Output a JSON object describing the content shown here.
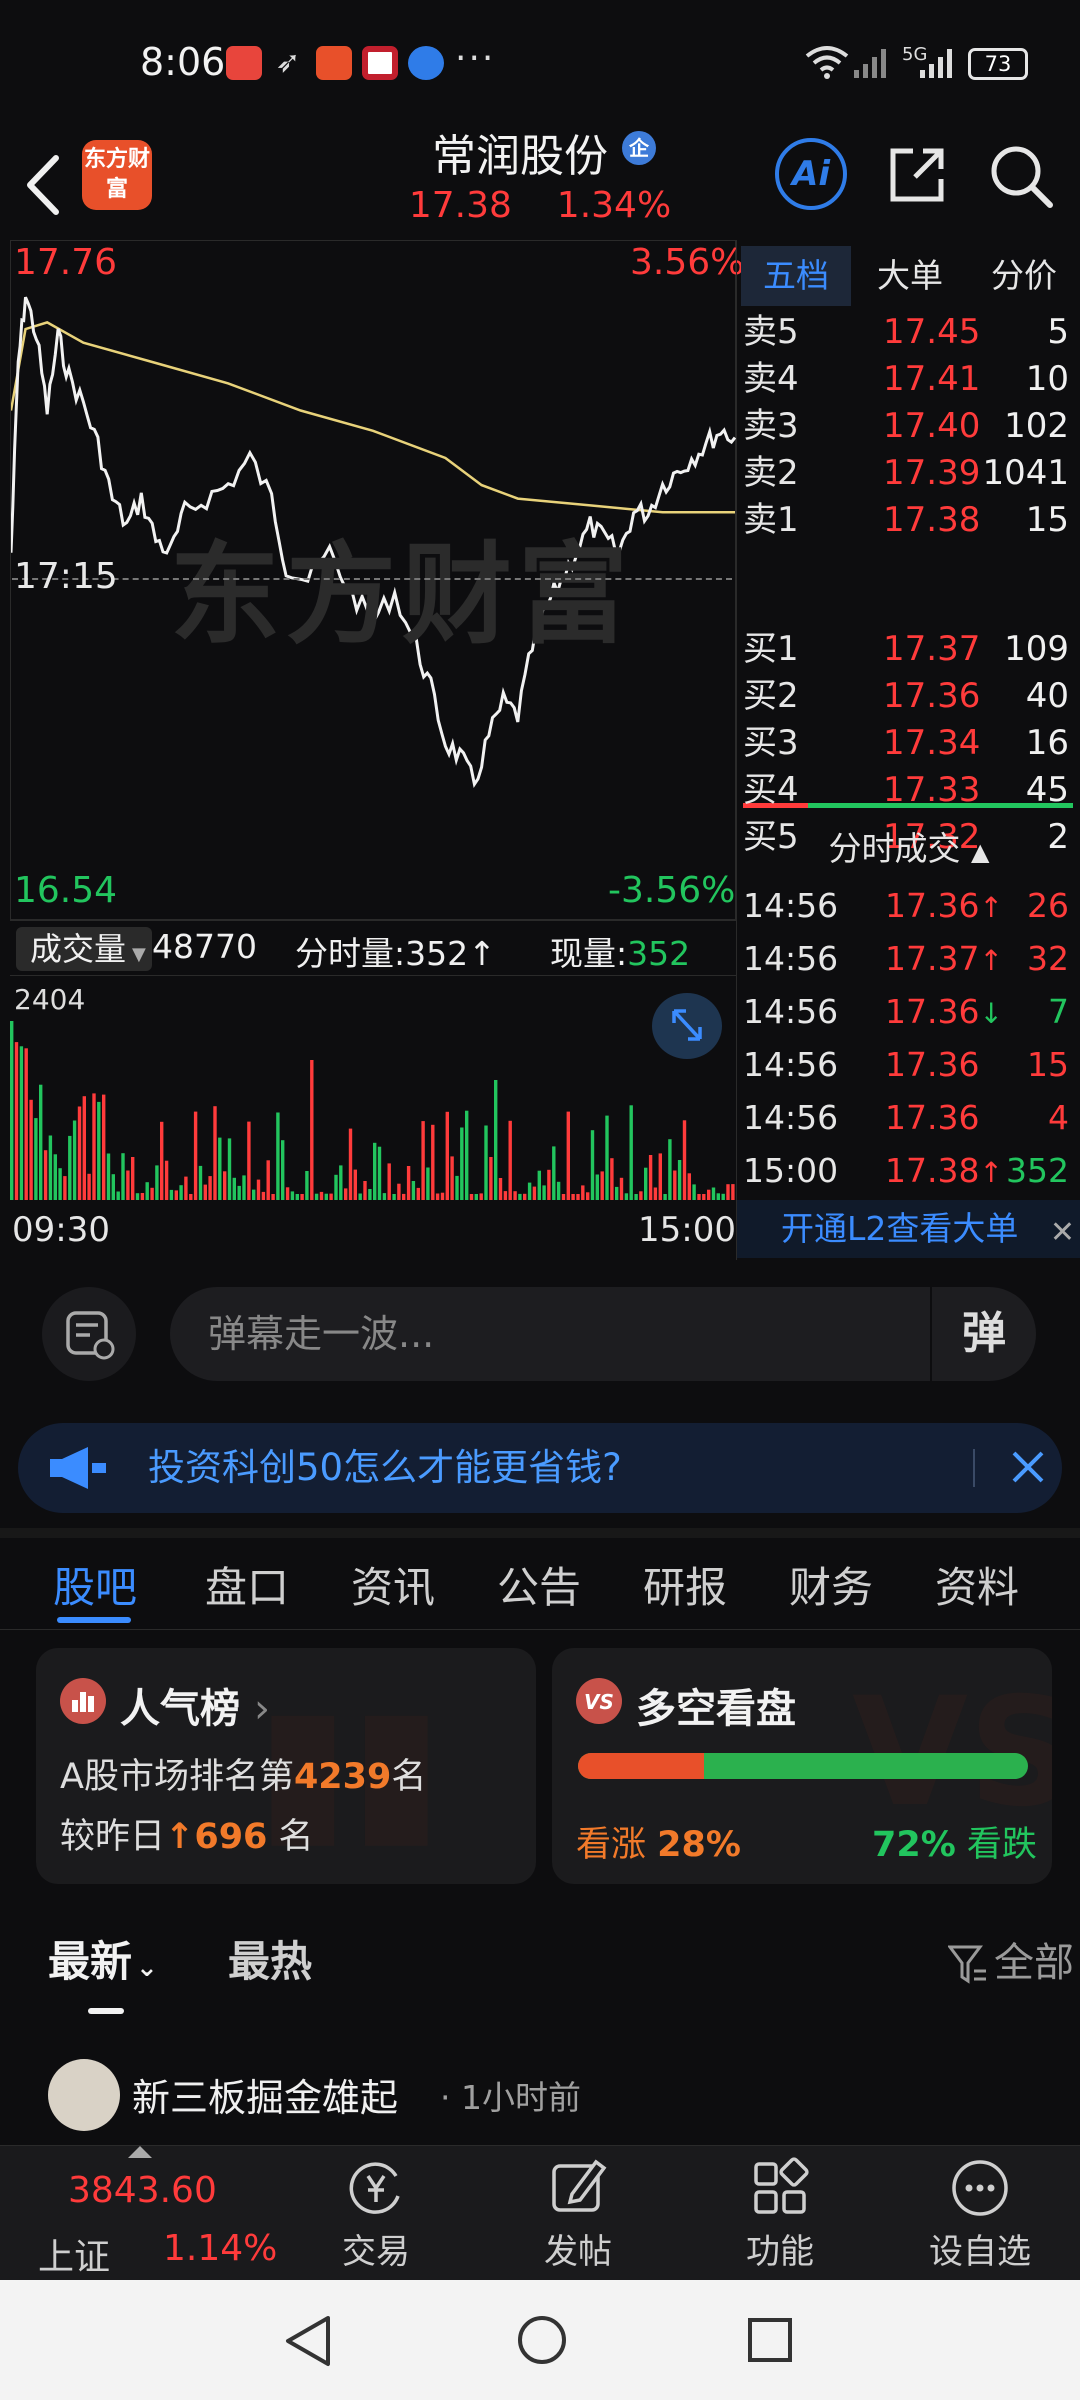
{
  "status_bar": {
    "time": "8:06",
    "dots": "···",
    "network_label": "5G",
    "battery": "73"
  },
  "header": {
    "logo_text": "东方财富",
    "stock_name": "常润股份",
    "badge": "企",
    "price": "17.38",
    "change_pct": "1.34%",
    "ai_label": "Ai"
  },
  "chart": {
    "high_price": "17.76",
    "low_price": "16.54",
    "mid_price": "17:15",
    "high_pct": "3.56%",
    "low_pct": "-3.56%",
    "watermark": "东方财富"
  },
  "volume_bar": {
    "select_label": "成交量",
    "total": "48770",
    "period_label": "分时量:",
    "period_value": "352",
    "current_label": "现量:",
    "current_value": "352",
    "max_volume": "2404",
    "time_start": "09:30",
    "time_end": "15:00"
  },
  "side_panel": {
    "tabs": [
      "五档",
      "大单",
      "分价"
    ],
    "asks": [
      {
        "label": "卖5",
        "price": "17.45",
        "qty": "5"
      },
      {
        "label": "卖4",
        "price": "17.41",
        "qty": "10"
      },
      {
        "label": "卖3",
        "price": "17.40",
        "qty": "102"
      },
      {
        "label": "卖2",
        "price": "17.39",
        "qty": "1041"
      },
      {
        "label": "卖1",
        "price": "17.38",
        "qty": "15"
      }
    ],
    "bids": [
      {
        "label": "买1",
        "price": "17.37",
        "qty": "109"
      },
      {
        "label": "买2",
        "price": "17.36",
        "qty": "40"
      },
      {
        "label": "买3",
        "price": "17.34",
        "qty": "16"
      },
      {
        "label": "买4",
        "price": "17.33",
        "qty": "45"
      },
      {
        "label": "买5",
        "price": "17.32",
        "qty": "2"
      }
    ],
    "ticks_title": "分时成交",
    "ticks": [
      {
        "time": "14:56",
        "price": "17.36",
        "arrow": "↑",
        "qty": "26",
        "dir": "up"
      },
      {
        "time": "14:56",
        "price": "17.37",
        "arrow": "↑",
        "qty": "32",
        "dir": "up"
      },
      {
        "time": "14:56",
        "price": "17.36",
        "arrow": "↓",
        "qty": "7",
        "dir": "down"
      },
      {
        "time": "14:56",
        "price": "17.36",
        "arrow": "",
        "qty": "15",
        "dir": "up"
      },
      {
        "time": "14:56",
        "price": "17.36",
        "arrow": "",
        "qty": "4",
        "dir": "up"
      },
      {
        "time": "15:00",
        "price": "17.38",
        "arrow": "↑",
        "qty": "352",
        "dir": "mixed"
      }
    ],
    "l2_promo": "开通L2查看大单"
  },
  "danmaku": {
    "placeholder": "弹幕走一波..."
  },
  "announcement": {
    "text": "投资科创50怎么才能更省钱?"
  },
  "tabs": [
    "股吧",
    "盘口",
    "资讯",
    "公告",
    "研报",
    "财务",
    "资料"
  ],
  "popularity": {
    "title": "人气榜",
    "rank_prefix": "A股市场排名第",
    "rank": "4239",
    "rank_suffix": "名",
    "change_prefix": "较昨日",
    "change": "696",
    "change_suffix": "名"
  },
  "bull_bear": {
    "title": "多空看盘",
    "bull_label": "看涨",
    "bull_pct": "28%",
    "bear_label": "看跌",
    "bear_pct": "72%",
    "bull_fraction": 0.28
  },
  "feed": {
    "newest": "最新",
    "hot": "最热",
    "filter": "全部",
    "post_user": "新三板掘金雄起",
    "post_time": "· 1小时前"
  },
  "toolbar": {
    "index_value": "3843.60",
    "index_name": "上证",
    "index_pct": "1.14%",
    "items": [
      "交易",
      "发帖",
      "功能",
      "设自选"
    ]
  },
  "colors": {
    "up": "#ff3b3b",
    "down": "#22c55e",
    "accent": "#3b8cff",
    "avg_line": "#e8d27a"
  }
}
